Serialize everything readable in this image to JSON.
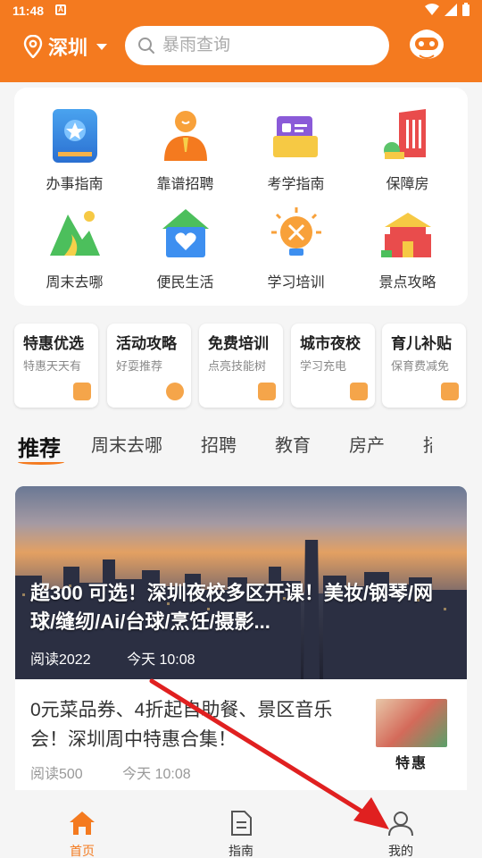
{
  "status": {
    "time": "11:48",
    "notif_glyph": "A"
  },
  "header": {
    "city": "深圳",
    "search_placeholder": "暴雨查询"
  },
  "services": [
    {
      "label": "办事指南",
      "icon": "guide-book-icon"
    },
    {
      "label": "靠谱招聘",
      "icon": "recruit-person-icon"
    },
    {
      "label": "考学指南",
      "icon": "study-folder-icon"
    },
    {
      "label": "保障房",
      "icon": "housing-building-icon"
    },
    {
      "label": "周末去哪",
      "icon": "mountain-icon"
    },
    {
      "label": "便民生活",
      "icon": "heart-house-icon"
    },
    {
      "label": "学习培训",
      "icon": "lightbulb-tools-icon"
    },
    {
      "label": "景点攻略",
      "icon": "temple-icon"
    }
  ],
  "promos": [
    {
      "title": "特惠优选",
      "subtitle": "特惠天天有"
    },
    {
      "title": "活动攻略",
      "subtitle": "好耍推荐"
    },
    {
      "title": "免费培训",
      "subtitle": "点亮技能树"
    },
    {
      "title": "城市夜校",
      "subtitle": "学习充电"
    },
    {
      "title": "育儿补贴",
      "subtitle": "保育费减免"
    }
  ],
  "tabs": [
    "推荐",
    "周末去哪",
    "招聘",
    "教育",
    "房产",
    "招"
  ],
  "feature": {
    "title": "超300 可选！深圳夜校多区开课！美妆/钢琴/网球/缝纫/Ai/台球/烹饪/摄影...",
    "reads": "阅读2022",
    "time": "今天 10:08"
  },
  "article": {
    "title": "0元菜品券、4折起自助餐、景区音乐会！深圳周中特惠合集！",
    "reads": "阅读500",
    "time": "今天 10:08",
    "thumb_caption": "特惠"
  },
  "bottom_nav": [
    {
      "label": "首页",
      "active": true
    },
    {
      "label": "指南",
      "active": false
    },
    {
      "label": "我的",
      "active": false
    }
  ],
  "colors": {
    "brand": "#f47a1f",
    "annotation_arrow": "#e02020"
  }
}
